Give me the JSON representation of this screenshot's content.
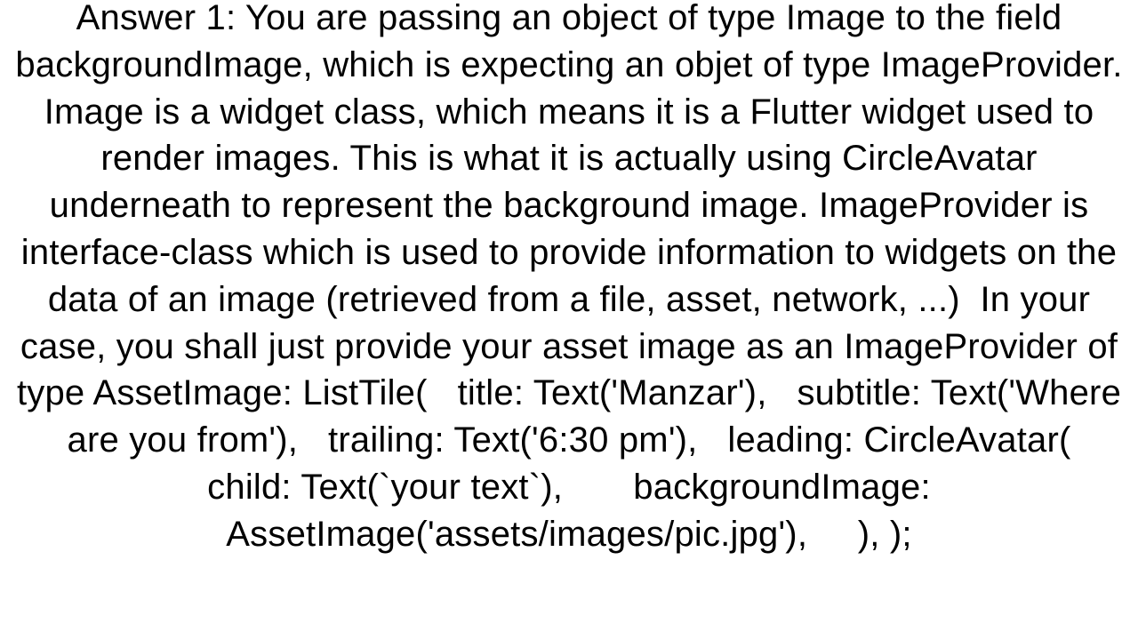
{
  "answer": {
    "text": "Answer 1: You are passing an object of type Image to the field backgroundImage, which is expecting an objet of type ImageProvider.  Image is a widget class, which means it is a Flutter widget used to render images. This is what it is actually using CircleAvatar underneath to represent the background image. ImageProvider is interface-class which is used to provide information to widgets on the data of an image (retrieved from a file, asset, network, ...)  In your case, you shall just provide your asset image as an ImageProvider of type AssetImage: ListTile(   title: Text('Manzar'),   subtitle: Text('Where are you from'),   trailing: Text('6:30 pm'),   leading: CircleAvatar(       child: Text(`your text`),       backgroundImage: AssetImage('assets/images/pic.jpg'),     ), );"
  }
}
